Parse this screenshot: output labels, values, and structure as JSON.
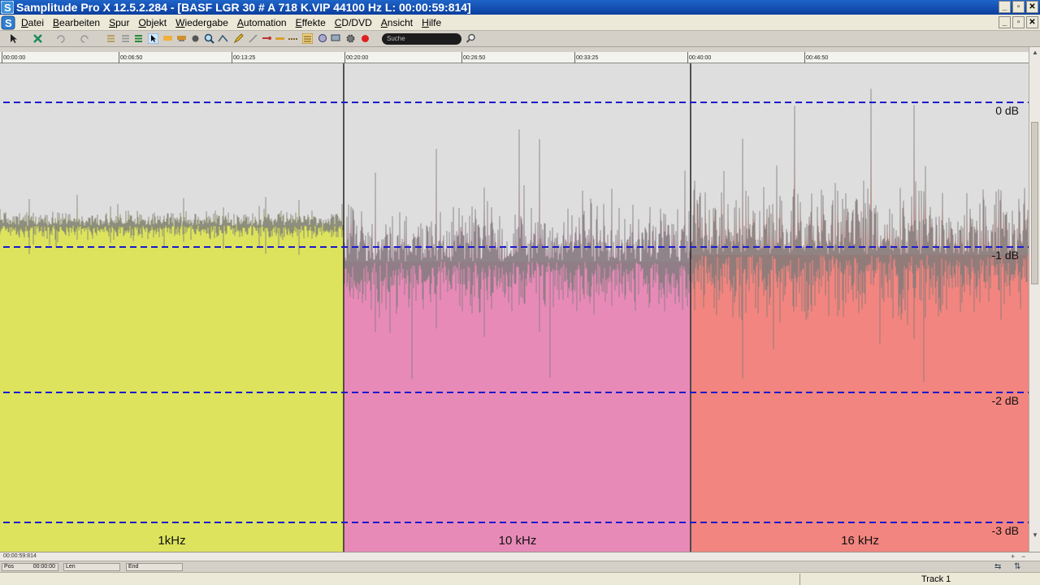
{
  "window": {
    "title": "Samplitude Pro X 12.5.2.284 - [BASF LGR 30 # A 718 K.VIP   44100 Hz L: 00:00:59:814]",
    "controls": [
      "_",
      "▫",
      "✕"
    ]
  },
  "menu": {
    "items": [
      "Datei",
      "Bearbeiten",
      "Spur",
      "Objekt",
      "Wiedergabe",
      "Automation",
      "Effekte",
      "CD/DVD",
      "Ansicht",
      "Hilfe"
    ]
  },
  "toolbar": {
    "search_placeholder": "Suche"
  },
  "ruler": {
    "ticks": [
      {
        "label": "00:00:00",
        "t": 0
      },
      {
        "label": "00:06:50",
        "t": 6.833
      },
      {
        "label": "00:13:25",
        "t": 13.417
      },
      {
        "label": "00:20:00",
        "t": 20.0
      },
      {
        "label": "00:26:50",
        "t": 26.833
      },
      {
        "label": "00:33:25",
        "t": 33.417
      },
      {
        "label": "00:40:00",
        "t": 40.0
      },
      {
        "label": "00:46:50",
        "t": 46.833
      }
    ]
  },
  "waveform": {
    "db_lines": [
      "0 dB",
      "-1 dB",
      "-2 dB",
      "-3 dB"
    ],
    "segments": [
      {
        "label": "1kHz",
        "color": "#dde35c",
        "level_db": -0.85,
        "variation_db": 0.12
      },
      {
        "label": "10 kHz",
        "color": "#e88ab8",
        "level_db": -1.1,
        "variation_db": 0.45
      },
      {
        "label": "16 kHz",
        "color": "#f2857f",
        "level_db": -1.05,
        "variation_db": 0.55
      }
    ],
    "guide_color": "#1a1acc",
    "peak_color": "#7a7a7a"
  },
  "position": {
    "small": "00:00:59:814"
  },
  "status": {
    "pos_label": "Pos",
    "pos_value": "00:00:00",
    "len_label": "Len",
    "end_label": "End"
  },
  "bottom": {
    "track": "Track 1"
  }
}
